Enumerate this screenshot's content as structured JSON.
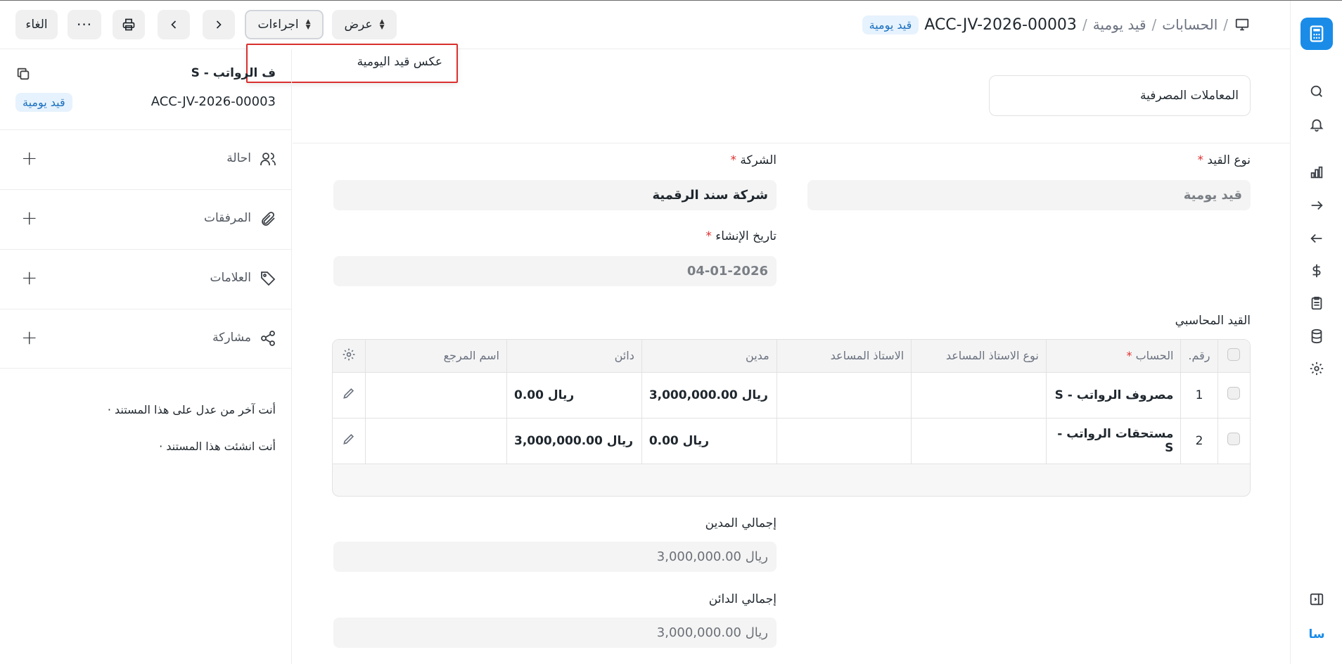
{
  "header": {
    "breadcrumb": [
      "الحسابات",
      "قيد يومية"
    ],
    "doc_id": "ACC-JV-2026-00003",
    "status_badge": "قيد يومية",
    "view_label": "عرض",
    "actions_label": "اجراءات",
    "cancel_label": "الغاء"
  },
  "dropdown": {
    "items": [
      "عكس قيد اليومية"
    ]
  },
  "rail": {
    "avatar": "سا"
  },
  "sidebar": {
    "title": "ف الرواتب - S",
    "doc_id": "ACC-JV-2026-00003",
    "badge": "قيد يومية",
    "sections": [
      {
        "label": "احالة",
        "icon": "users-icon"
      },
      {
        "label": "المرفقات",
        "icon": "paperclip-icon"
      },
      {
        "label": "العلامات",
        "icon": "tag-icon"
      },
      {
        "label": "مشاركة",
        "icon": "share-icon"
      }
    ],
    "activity": [
      "أنت آخر من عدل على هذا المستند ·",
      "أنت انشئت هذا المستند ·"
    ]
  },
  "form": {
    "bank_transactions": "المعاملات المصرفية",
    "entry_type_label": "نوع القيد",
    "entry_type_value": "قيد يومية",
    "company_label": "الشركة",
    "company_value": "شركة سند الرقمية",
    "created_label": "تاريخ الإنشاء",
    "created_value": "04-01-2026",
    "accounting_title": "القيد المحاسبي",
    "table": {
      "headers": {
        "no": "رقم.",
        "account": "الحساب",
        "party_type": "نوع الاستاذ المساعد",
        "party": "الاستاذ المساعد",
        "debit": "مدين",
        "credit": "دائن",
        "ref": "اسم المرجع"
      },
      "rows": [
        {
          "no": "1",
          "account": "مصروف الرواتب - S",
          "party_type": "",
          "party": "",
          "debit": "ريال 3,000,000.00",
          "credit": "ريال 0.00",
          "ref": ""
        },
        {
          "no": "2",
          "account": "مستحقات الرواتب - S",
          "party_type": "",
          "party": "",
          "debit": "ريال 0.00",
          "credit": "ريال 3,000,000.00",
          "ref": ""
        }
      ]
    },
    "total_debit_label": "إجمالي المدين",
    "total_debit_value": "ريال 3,000,000.00",
    "total_credit_label": "إجمالي الدائن",
    "total_credit_value": "ريال 3,000,000.00"
  },
  "colors": {
    "accent": "#1a8ce8",
    "badge_bg": "#e6f2fd",
    "required": "#e03131",
    "dropdown_border": "#d9302f"
  }
}
